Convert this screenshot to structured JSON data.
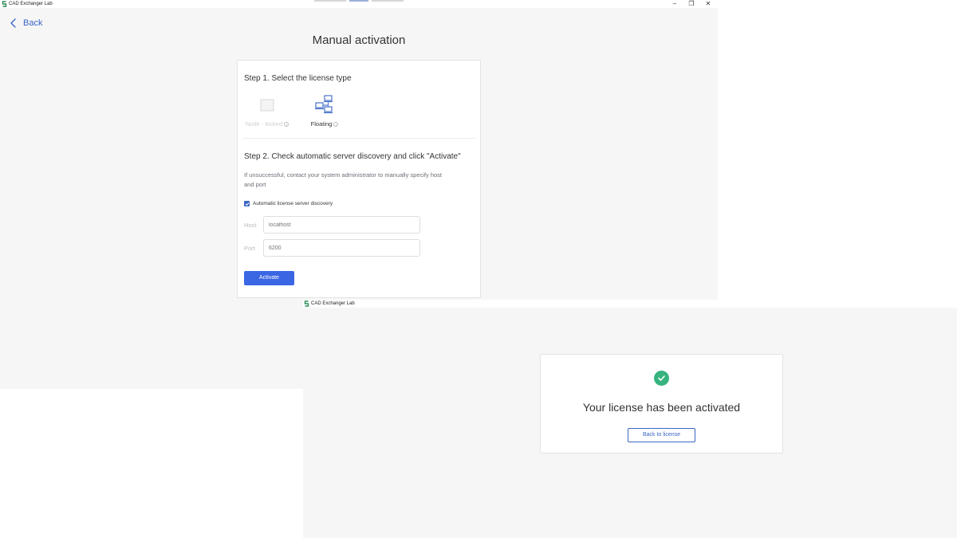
{
  "window1": {
    "app_title": "CAD Exchanger Lab",
    "controls": {
      "minimize": "–",
      "restore": "❐",
      "close": "✕"
    },
    "back_label": "Back",
    "title": "Manual activation",
    "step1": {
      "heading": "Step 1. Select the license type",
      "types": [
        {
          "label": "Node - locked",
          "state": "disabled",
          "icon": "node-locked-icon"
        },
        {
          "label": "Floating",
          "state": "selected",
          "icon": "floating-network-icon"
        }
      ]
    },
    "step2": {
      "heading": "Step 2. Check automatic server discovery and click \"Activate\"",
      "hint": "If unsuccessful, contact your system administrator to manually specify host and port",
      "auto_discovery": {
        "label": "Automatic license server discovery",
        "checked": true
      },
      "host": {
        "label": "Host",
        "placeholder": "localhost"
      },
      "port": {
        "label": "Port",
        "placeholder": "6200"
      },
      "activate_label": "Activate"
    }
  },
  "window2": {
    "app_title": "CAD Exchanger Lab",
    "message": "Your license has been activated",
    "back_to_license_label": "Back to license"
  },
  "colors": {
    "accent": "#3a66e4",
    "link": "#3a66c4",
    "success": "#36b37e",
    "background": "#f6f6f6"
  }
}
